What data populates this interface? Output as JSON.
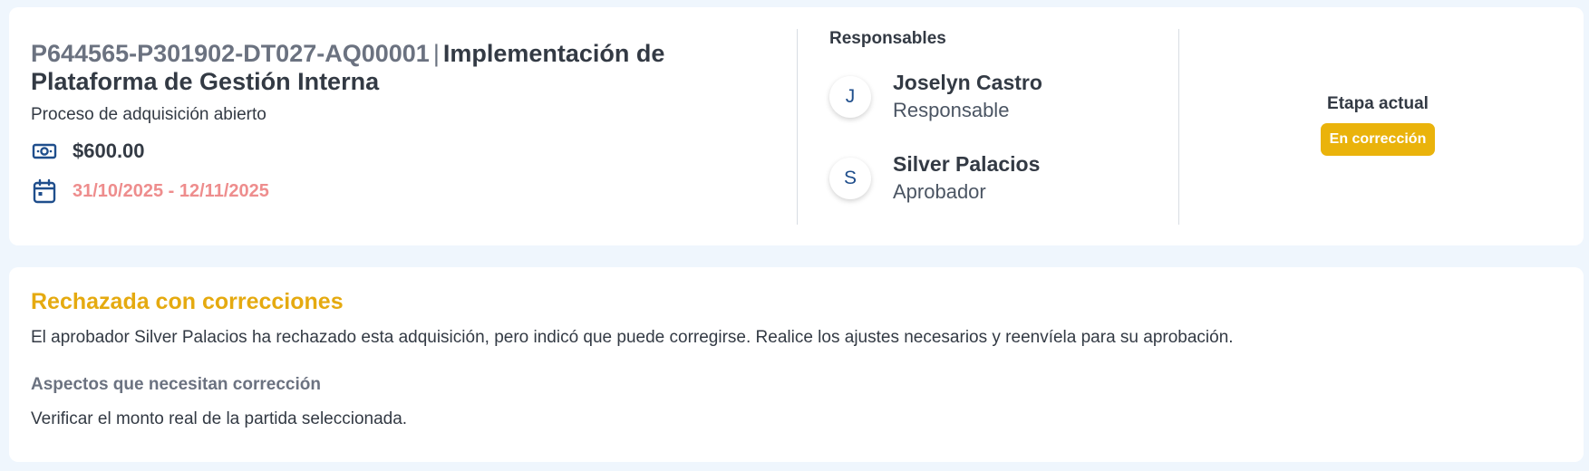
{
  "header": {
    "code": "P644565-P301902-DT027-AQ00001",
    "separator": "|",
    "title_line1": "Implementación de",
    "title_line2": "Plataforma de Gestión Interna",
    "subtitle": "Proceso de adquisición abierto",
    "amount": "$600.00",
    "dates": "31/10/2025 - 12/11/2025",
    "icons": {
      "amount": "money-icon",
      "dates": "calendar-icon"
    }
  },
  "responsables": {
    "title": "Responsables",
    "people": [
      {
        "initial": "J",
        "name": "Joselyn Castro",
        "role": "Responsable"
      },
      {
        "initial": "S",
        "name": "Silver Palacios",
        "role": "Aprobador"
      }
    ]
  },
  "stage": {
    "label": "Etapa actual",
    "badge": "En corrección"
  },
  "rejection": {
    "title": "Rechazada con correcciones",
    "message": "El aprobador Silver Palacios ha rechazado esta adquisición, pero indicó que puede corregirse. Realice los ajustes necesarios y reenvíela para su aprobación.",
    "aspects_label": "Aspectos que necesitan corrección",
    "aspects_text": "Verificar el monto real de la partida seleccionada."
  },
  "colors": {
    "background": "#eff6fd",
    "accent_blue": "#1f4e8c",
    "warning": "#eab30b",
    "dates": "#ee8d8d"
  }
}
